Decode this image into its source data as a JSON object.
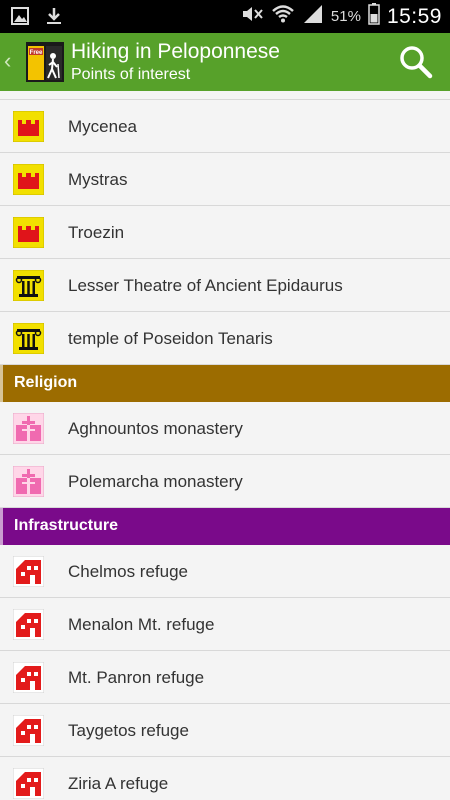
{
  "status_bar": {
    "battery_percent": "51%",
    "time": "15:59"
  },
  "action_bar": {
    "title": "Hiking in Peloponnese",
    "subtitle": "Points of interest",
    "logo_badge": "Free"
  },
  "colors": {
    "action_bar": "#57a12a",
    "religion_header": "#9c6c00",
    "infrastructure_header": "#7a0a8a"
  },
  "castles": [
    {
      "label": "Mycenea",
      "icon": "castle-icon"
    },
    {
      "label": "Mystras",
      "icon": "castle-icon"
    },
    {
      "label": "Troezin",
      "icon": "castle-icon"
    }
  ],
  "ancient": [
    {
      "label": "Lesser Theatre of Ancient Epidaurus",
      "icon": "ionic-column-icon"
    },
    {
      "label": "temple of Poseidon Tenaris",
      "icon": "ionic-column-icon"
    }
  ],
  "religion": {
    "header": "Religion",
    "items": [
      {
        "label": "Aghnountos monastery",
        "icon": "monastery-cross-icon"
      },
      {
        "label": "Polemarcha monastery",
        "icon": "monastery-cross-icon"
      }
    ]
  },
  "infrastructure": {
    "header": "Infrastructure",
    "items": [
      {
        "label": "Chelmos refuge",
        "icon": "refuge-house-icon"
      },
      {
        "label": "Menalon Mt. refuge",
        "icon": "refuge-house-icon"
      },
      {
        "label": "Mt. Panron refuge",
        "icon": "refuge-house-icon"
      },
      {
        "label": "Taygetos refuge",
        "icon": "refuge-house-icon"
      },
      {
        "label": "Ziria A refuge",
        "icon": "refuge-house-icon"
      }
    ]
  }
}
